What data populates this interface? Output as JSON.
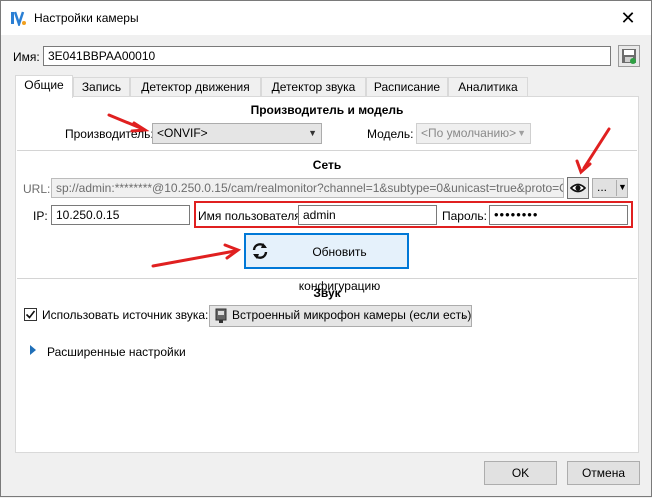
{
  "window": {
    "title": "Настройки камеры",
    "close_glyph": "✕"
  },
  "name_row": {
    "label": "Имя:",
    "value": "3E041BBPAA00010"
  },
  "tabs": [
    {
      "label": "Общие",
      "active": true
    },
    {
      "label": "Запись",
      "active": false
    },
    {
      "label": "Детектор движения",
      "active": false
    },
    {
      "label": "Детектор звука",
      "active": false
    },
    {
      "label": "Расписание",
      "active": false
    },
    {
      "label": "Аналитика",
      "active": false
    }
  ],
  "manufacturer_section": {
    "title": "Производитель и модель",
    "manufacturer_label": "Производитель:",
    "manufacturer_value": "<ONVIF>",
    "model_label": "Модель:",
    "model_value": "<По умолчанию>"
  },
  "network_section": {
    "title": "Сеть",
    "url_label": "URL:",
    "url_value": "sp://admin:********@10.250.0.15/cam/realmonitor?channel=1&subtype=0&unicast=true&proto=Onvif",
    "more_label": "...",
    "ip_label": "IP:",
    "ip_value": "10.250.0.15",
    "username_label": "Имя пользователя:",
    "username_value": "admin",
    "password_label": "Пароль:",
    "password_value": "••••••••",
    "refresh_button_label": "Обновить конфигурацию"
  },
  "sound_section": {
    "title": "Звук",
    "use_source_label": "Использовать источник звука:",
    "use_source_checked": true,
    "source_value": "Встроенный микрофон камеры (если есть)"
  },
  "advanced": {
    "label": "Расширенные настройки"
  },
  "footer": {
    "ok_label": "OK",
    "cancel_label": "Отмена"
  },
  "colors": {
    "annotation_red": "#e02020",
    "accent_blue": "#0078d7"
  },
  "icons": [
    "app-logo-icon",
    "close-icon",
    "save-name-icon",
    "eye-icon",
    "refresh-icon",
    "microphone-icon",
    "expand-triangle-icon",
    "checkbox-checked-icon"
  ]
}
